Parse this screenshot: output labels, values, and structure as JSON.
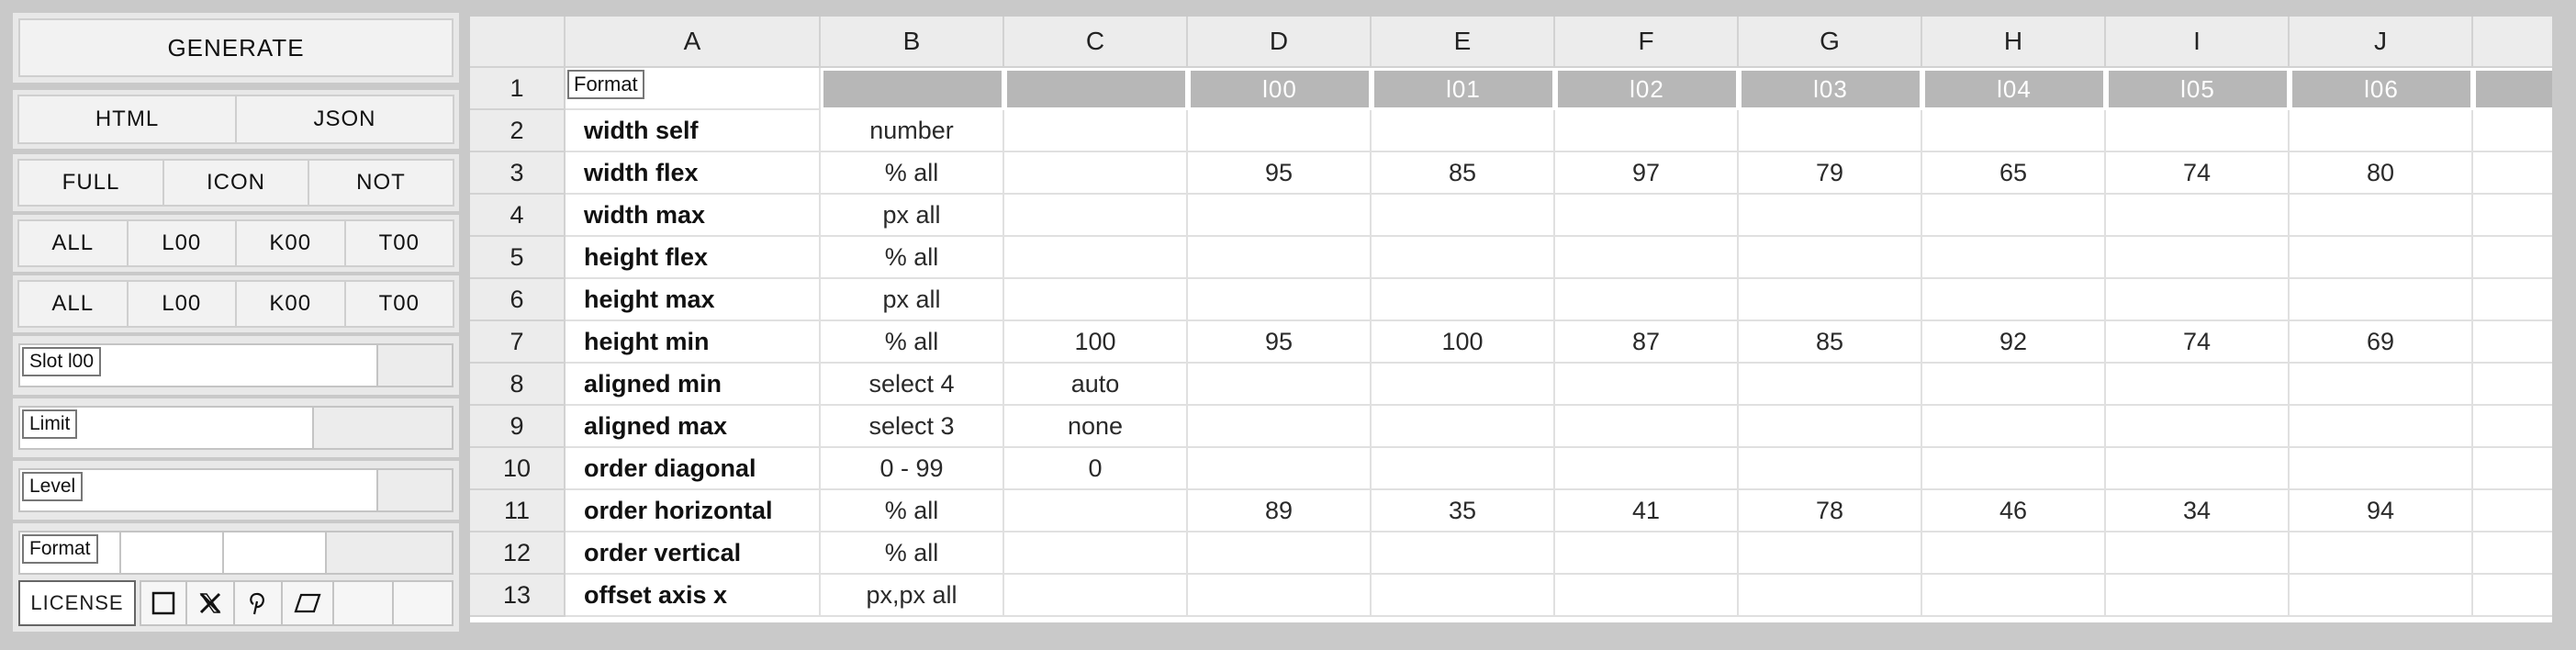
{
  "panel": {
    "generate": "GENERATE",
    "export": [
      "HTML",
      "JSON"
    ],
    "modes": [
      "FULL",
      "ICON",
      "NOT"
    ],
    "filter_a": [
      "ALL",
      "L00",
      "K00",
      "T00"
    ],
    "filter_b": [
      "ALL",
      "L00",
      "K00",
      "T00"
    ],
    "slot_label": "Slot l00",
    "limit_label": "Limit",
    "level_label": "Level",
    "format_label": "Format",
    "license_label": "LICENSE",
    "icons": [
      "square-icon",
      "x-logo-icon",
      "pinterest-icon",
      "parallelogram-icon"
    ]
  },
  "grid": {
    "columns": [
      "A",
      "B",
      "C",
      "D",
      "E",
      "F",
      "G",
      "H",
      "I",
      "J",
      ""
    ],
    "format_chip": "Format",
    "header_row": [
      "",
      "",
      "",
      "l00",
      "l01",
      "l02",
      "l03",
      "l04",
      "l05",
      "l06",
      ""
    ],
    "rows": [
      {
        "n": "2",
        "cells": [
          "width self",
          "number",
          "",
          "",
          "",
          "",
          "",
          "",
          "",
          "",
          ""
        ]
      },
      {
        "n": "3",
        "cells": [
          "width flex",
          "% all",
          "",
          "95",
          "85",
          "97",
          "79",
          "65",
          "74",
          "80",
          ""
        ]
      },
      {
        "n": "4",
        "cells": [
          "width max",
          "px all",
          "",
          "",
          "",
          "",
          "",
          "",
          "",
          "",
          ""
        ]
      },
      {
        "n": "5",
        "cells": [
          "height flex",
          "% all",
          "",
          "",
          "",
          "",
          "",
          "",
          "",
          "",
          ""
        ]
      },
      {
        "n": "6",
        "cells": [
          "height max",
          "px all",
          "",
          "",
          "",
          "",
          "",
          "",
          "",
          "",
          ""
        ]
      },
      {
        "n": "7",
        "cells": [
          "height min",
          "% all",
          "100",
          "95",
          "100",
          "87",
          "85",
          "92",
          "74",
          "69",
          ""
        ]
      },
      {
        "n": "8",
        "cells": [
          "aligned min",
          "select 4",
          "auto",
          "",
          "",
          "",
          "",
          "",
          "",
          "",
          ""
        ]
      },
      {
        "n": "9",
        "cells": [
          "aligned max",
          "select 3",
          "none",
          "",
          "",
          "",
          "",
          "",
          "",
          "",
          ""
        ]
      },
      {
        "n": "10",
        "cells": [
          "order diagonal",
          "0 - 99",
          "0",
          "",
          "",
          "",
          "",
          "",
          "",
          "",
          ""
        ]
      },
      {
        "n": "11",
        "cells": [
          "order horizontal",
          "% all",
          "",
          "89",
          "35",
          "41",
          "78",
          "46",
          "34",
          "94",
          ""
        ]
      },
      {
        "n": "12",
        "cells": [
          "order vertical",
          "% all",
          "",
          "",
          "",
          "",
          "",
          "",
          "",
          "",
          ""
        ]
      },
      {
        "n": "13",
        "cells": [
          "offset axis x",
          "px,px all",
          "",
          "",
          "",
          "",
          "",
          "",
          "",
          "",
          ""
        ]
      }
    ],
    "first_row_number": "1"
  }
}
